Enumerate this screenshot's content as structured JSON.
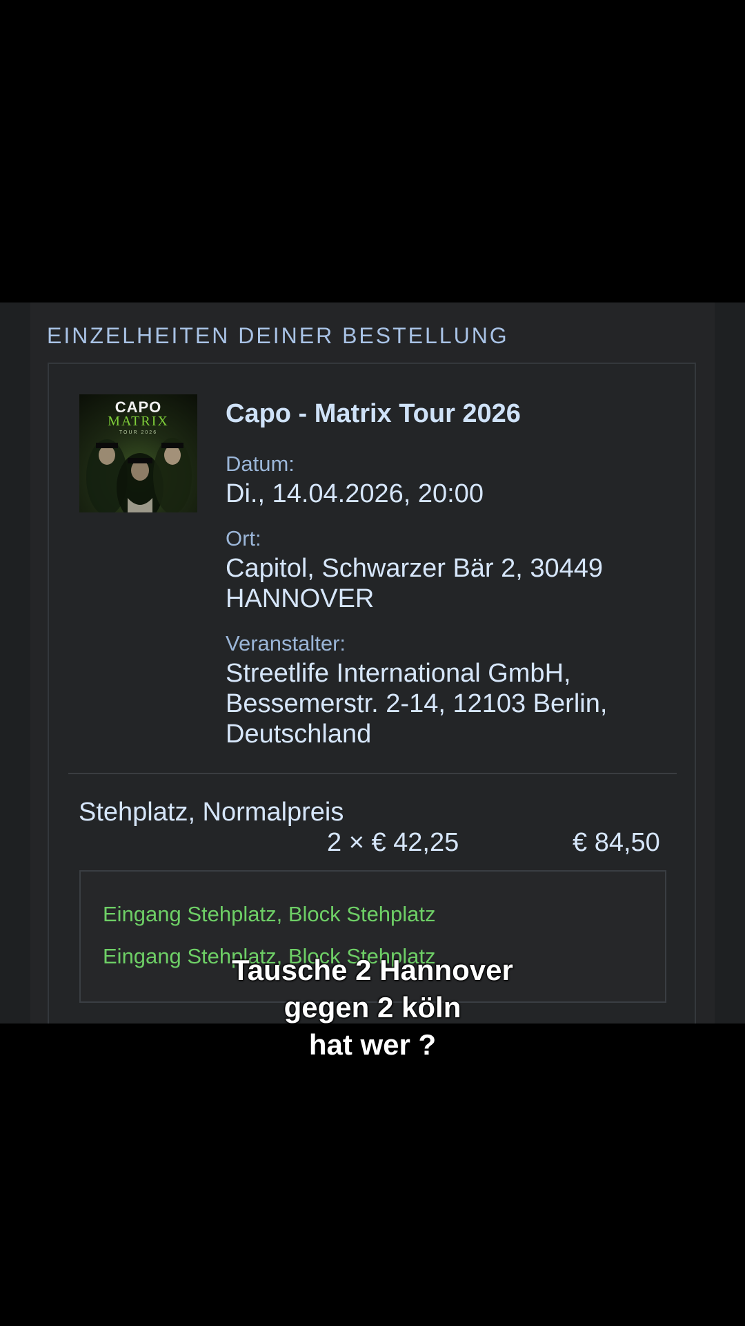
{
  "section_title": "EINZELHEITEN DEINER BESTELLUNG",
  "poster": {
    "title": "CAPO",
    "subtitle": "MATRIX",
    "tour_line": "TOUR 2026"
  },
  "event": {
    "title": "Capo - Matrix Tour 2026",
    "date_label": "Datum:",
    "date_value": "Di., 14.04.2026, 20:00",
    "venue_label": "Ort:",
    "venue_value": "Capitol, Schwarzer Bär 2, 30449 HANNOVER",
    "organizer_label": "Veranstalter:",
    "organizer_value": "Streetlife International GmbH, Bessemerstr. 2-14, 12103 Berlin, Deutschland"
  },
  "ticket": {
    "type": "Stehplatz, Normalpreis",
    "quantity_price": "2 × € 42,25",
    "total": "€ 84,50",
    "entries": [
      "Eingang Stehplatz, Block Stehplatz",
      "Eingang Stehplatz, Block Stehplatz"
    ]
  },
  "caption": {
    "line1": "Tausche 2 Hannover",
    "line2": "gegen 2 köln",
    "line3": "hat wer ?"
  },
  "colors": {
    "background": "#000000",
    "panel": "#242527",
    "heading_blue": "#a9c3e6",
    "text_light": "#d6e6fa",
    "entry_green": "#6ecf66"
  }
}
